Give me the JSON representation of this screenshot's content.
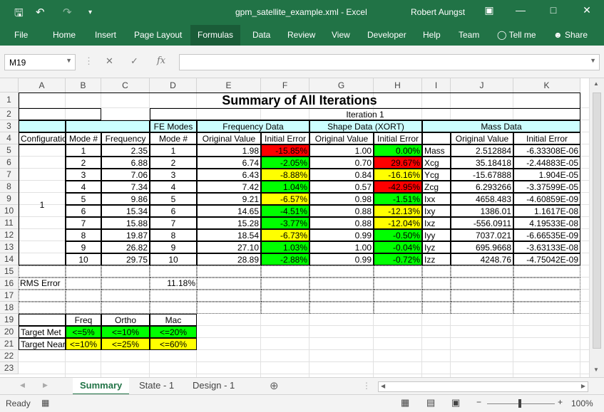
{
  "window": {
    "title": "gpm_satellite_example.xml  -  Excel",
    "user": "Robert Aungst"
  },
  "ribbon": {
    "tabs": [
      "File",
      "Home",
      "Insert",
      "Page Layout",
      "Formulas",
      "Data",
      "Review",
      "View",
      "Developer",
      "Help",
      "Team",
      "Tell me",
      "Share"
    ]
  },
  "formula": {
    "namebox": "M19",
    "fx": "fx",
    "value": ""
  },
  "columns": [
    "A",
    "B",
    "C",
    "D",
    "E",
    "F",
    "G",
    "H",
    "I",
    "J",
    "K"
  ],
  "rows": [
    "1",
    "2",
    "3",
    "4",
    "5",
    "6",
    "7",
    "8",
    "9",
    "10",
    "11",
    "12",
    "13",
    "14",
    "15",
    "16",
    "17",
    "18",
    "19",
    "20",
    "21",
    "22",
    "23"
  ],
  "sheet": {
    "title": "Summary of All Iterations",
    "iteration": "Iteration 1",
    "h3": {
      "fe": "FE Modes",
      "freq": "Frequency Data",
      "shape": "Shape Data (XORT)",
      "mass": "Mass Data"
    },
    "h4": {
      "config": "Configuration",
      "mode": "Mode #",
      "frequency": "Frequency",
      "fe_mode": "Mode #",
      "orig": "Original Value",
      "err": "Initial Error",
      "orig2": "Original Value",
      "err2": "Initial Error",
      "orig3": "Original Value",
      "err3": "Initial Error"
    },
    "config_value": "1",
    "data": [
      [
        "1",
        "2.35",
        "1",
        "1.98",
        "-15.85%",
        "1.00",
        "0.00%",
        "Mass",
        "2.512884",
        "-6.33308E-06"
      ],
      [
        "2",
        "6.88",
        "2",
        "6.74",
        "-2.05%",
        "0.70",
        "29.67%",
        "Xcg",
        "35.18418",
        "-2.44883E-05"
      ],
      [
        "3",
        "7.06",
        "3",
        "6.43",
        "-8.88%",
        "0.84",
        "-16.16%",
        "Ycg",
        "-15.67888",
        "1.904E-05"
      ],
      [
        "4",
        "7.34",
        "4",
        "7.42",
        "1.04%",
        "0.57",
        "-42.95%",
        "Zcg",
        "6.293266",
        "-3.37599E-05"
      ],
      [
        "5",
        "9.86",
        "5",
        "9.21",
        "-6.57%",
        "0.98",
        "-1.51%",
        "Ixx",
        "4658.483",
        "-4.60859E-09"
      ],
      [
        "6",
        "15.34",
        "6",
        "14.65",
        "-4.51%",
        "0.88",
        "-12.13%",
        "Ixy",
        "1386.01",
        "1.1617E-08"
      ],
      [
        "7",
        "15.88",
        "7",
        "15.28",
        "-3.77%",
        "0.88",
        "-12.04%",
        "Ixz",
        "-556.0911",
        "4.19533E-08"
      ],
      [
        "8",
        "19.87",
        "8",
        "18.54",
        "-6.73%",
        "0.99",
        "-0.50%",
        "Iyy",
        "7037.021",
        "-6.66535E-09"
      ],
      [
        "9",
        "26.82",
        "9",
        "27.10",
        "1.03%",
        "1.00",
        "-0.04%",
        "Iyz",
        "695.9668",
        "-3.63133E-08"
      ],
      [
        "10",
        "29.75",
        "10",
        "28.89",
        "-2.88%",
        "0.99",
        "-0.72%",
        "Izz",
        "4248.76",
        "-4.75042E-09"
      ]
    ],
    "rms_label": "RMS Error",
    "rms_value": "11.18%",
    "legend_headers": [
      "Freq",
      "Ortho",
      "Mac"
    ],
    "target_met": {
      "label": "Target Met",
      "values": [
        "<=5%",
        "<=10%",
        "<=20%"
      ]
    },
    "target_near": {
      "label": "Target Near",
      "values": [
        "<=10%",
        "<=25%",
        "<=60%"
      ]
    }
  },
  "sheets": [
    "Summary",
    "State - 1",
    "Design - 1"
  ],
  "status": {
    "ready": "Ready",
    "zoom": "100%"
  },
  "colors": {
    "accent": "#217346",
    "green": "#00ff00",
    "yellow": "#ffff00",
    "red": "#ff0000",
    "cyan": "#ccffff"
  }
}
